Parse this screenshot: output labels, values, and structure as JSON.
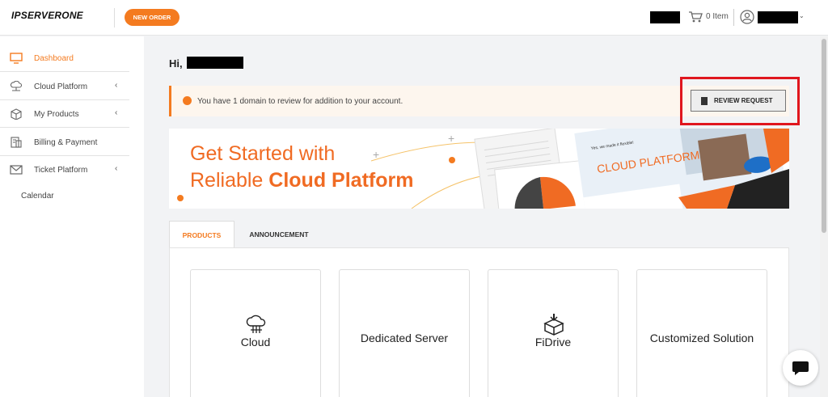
{
  "header": {
    "logo_text": "IPSERVERONE",
    "new_order_label": "NEW ORDER",
    "cart_label": "0 Item",
    "accent_color": "#f47b20"
  },
  "sidebar": {
    "items": [
      {
        "label": "Dashboard",
        "icon": "monitor-icon",
        "active": true
      },
      {
        "label": "Cloud Platform",
        "icon": "cloud-network-icon",
        "submenu": true
      },
      {
        "label": "My Products",
        "icon": "box-icon",
        "submenu": true
      },
      {
        "label": "Billing & Payment",
        "icon": "invoice-icon"
      },
      {
        "label": "Ticket Platform",
        "icon": "envelope-icon",
        "submenu": true
      },
      {
        "label": "Calendar"
      }
    ]
  },
  "main": {
    "greeting": "Hi,",
    "alert_text": "You have 1 domain to review for addition to your account.",
    "review_button": "REVIEW REQUEST",
    "banner": {
      "line1": "Get Started with",
      "line2_prefix": "Reliable ",
      "line2_bold": "Cloud Platform",
      "mockup_heading": "CLOUD PLATFORM",
      "mockup_caption": "Yes, we made it flexible!"
    },
    "tabs": [
      "PRODUCTS",
      "ANNOUNCEMENT"
    ],
    "cards": [
      {
        "title": "Cloud",
        "icon": "cloud-server-icon"
      },
      {
        "title": "Dedicated Server"
      },
      {
        "title": "FiDrive",
        "icon": "drive-box-icon"
      },
      {
        "title": "Customized Solution"
      }
    ]
  },
  "chat": {
    "icon": "chat-bubble-icon"
  }
}
